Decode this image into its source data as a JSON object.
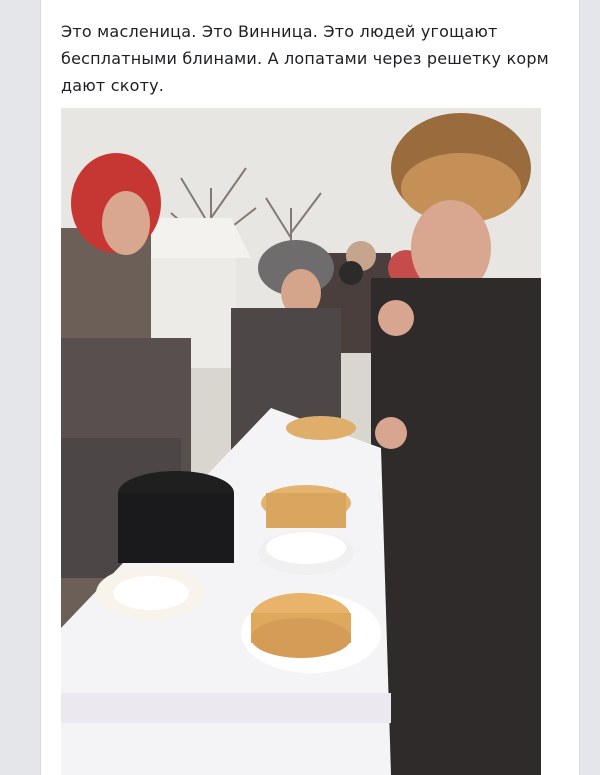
{
  "post": {
    "text": "Это масленица. Это Винница. Это людей угощают бесплатными блинами. А лопатами через решетку корм дают скоту."
  },
  "photo": {
    "description_icon": "photo-image"
  }
}
